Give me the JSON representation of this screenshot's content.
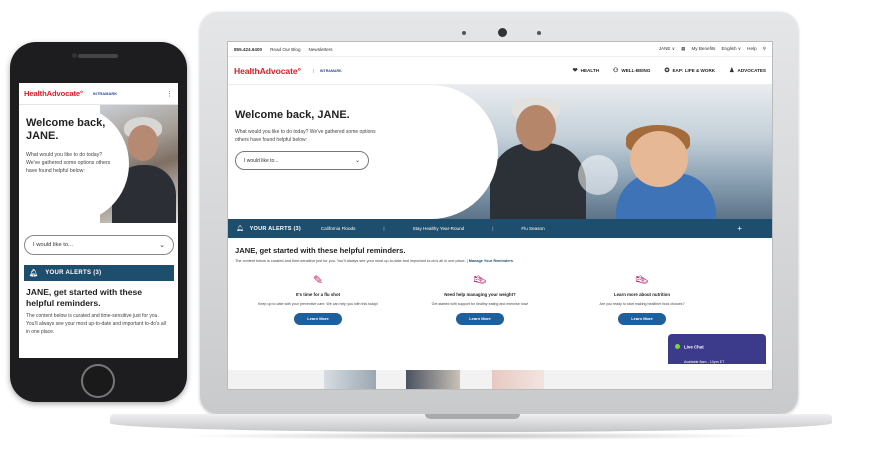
{
  "phone": {
    "logo": "HealthAdvocate",
    "logo_mark": "°",
    "partner": "INTRAMARK",
    "menu": "⋮",
    "welcome": "Welcome back, JANE.",
    "subtitle": "What would you like to do today? We've gathered some options others have found helpful below:",
    "select_placeholder": "I would like to...",
    "alerts_label": "YOUR ALERTS (3)",
    "reminders_title": "JANE, get started with these helpful reminders.",
    "reminders_text": "The content below is curated and time-sensitive just for you. You'll always see your most up-to-date and important to-do's all in one place."
  },
  "laptop": {
    "topbar": {
      "phone": "855.424.6400",
      "blog": "Read Our Blog",
      "newsletters": "Newsletters",
      "user": "JANE ∨",
      "benefits": "My Benefits",
      "language": "English ∨",
      "help": "Help"
    },
    "nav": {
      "logo": "HealthAdvocate",
      "partner": "INTRAMARK",
      "items": [
        {
          "label": "HEALTH",
          "icon": "heart-icon"
        },
        {
          "label": "WELL-BEING",
          "icon": "people-icon"
        },
        {
          "label": "EAP: LIFE & WORK",
          "icon": "compass-icon"
        },
        {
          "label": "ADVOCATES",
          "icon": "advocate-icon"
        }
      ]
    },
    "hero": {
      "welcome": "Welcome back, JANE.",
      "subtitle": "What would you like to do today? We've gathered some options others have found helpful below:",
      "select_placeholder": "I would like to..."
    },
    "alerts": {
      "title": "YOUR ALERTS (3)",
      "items": [
        "California Floods",
        "Stay Healthy Year-Round",
        "Flu Season"
      ],
      "plus": "+"
    },
    "reminders": {
      "title": "JANE, get started with these helpful reminders.",
      "text": "The content below is curated and time-sensitive just for you. You'll always see your most up-to-date and important to-do's all in one place.",
      "divider": "|",
      "manage_link": "Manage Your Reminders",
      "cards": [
        {
          "title": "It's time for a flu shot",
          "desc": "Keep up to date with your preventive care. We can help you with this today!",
          "button": "Learn More",
          "icon": "syringe-icon"
        },
        {
          "title": "Need help managing your weight?",
          "desc": "Get started with support for healthy eating and exercise now!",
          "button": "Learn More",
          "icon": "sneaker-icon"
        },
        {
          "title": "Learn more about nutrition",
          "desc": "Are you ready to start making healthier food choices?",
          "button": "Learn More",
          "icon": "sneaker-icon"
        }
      ]
    },
    "livechat": {
      "title": "Live Chat",
      "hours": "Available 8am - 10pm ET"
    }
  },
  "colors": {
    "brand_red": "#d6202c",
    "alert_blue": "#1e4e6e",
    "button_blue": "#1e5f9e",
    "livechat_purple": "#3c3a8a",
    "icon_magenta": "#c1246b"
  }
}
